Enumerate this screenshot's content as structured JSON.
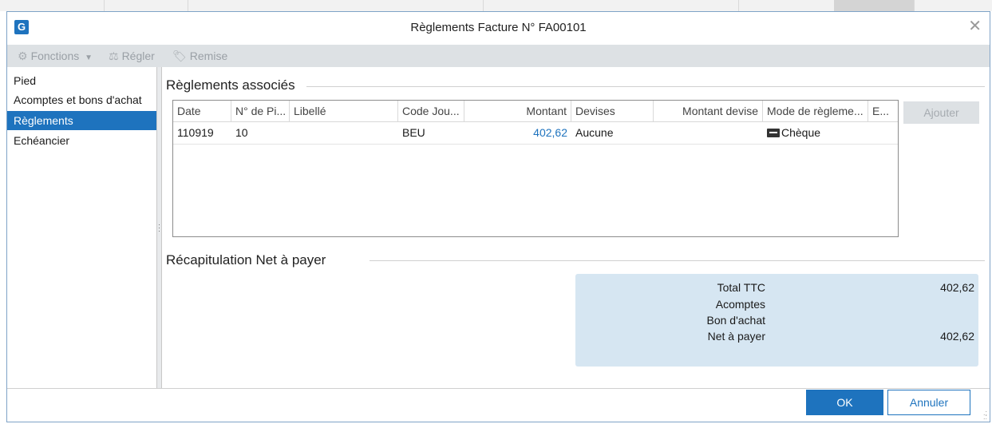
{
  "window": {
    "title": "Règlements Facture N° FA00101",
    "close_glyph": "✕",
    "app_icon_glyph": "G"
  },
  "toolbar": {
    "items": [
      {
        "label": "Fonctions",
        "icon": "gears-icon",
        "has_dropdown": true
      },
      {
        "label": "Régler",
        "icon": "scale-icon"
      },
      {
        "label": "Remise",
        "icon": "tag-icon"
      }
    ]
  },
  "nav": {
    "items": [
      {
        "label": "Pied",
        "selected": false
      },
      {
        "label": "Acomptes et bons d'achat",
        "selected": false
      },
      {
        "label": "Règlements",
        "selected": true
      },
      {
        "label": "Echéancier",
        "selected": false
      }
    ]
  },
  "payments": {
    "section_title": "Règlements associés",
    "add_button": "Ajouter",
    "columns": [
      "Date",
      "N° de Pi...",
      "Libellé",
      "Code Jou...",
      "Montant",
      "Devises",
      "Montant devise",
      "Mode de règleme...",
      "E..."
    ],
    "rows": [
      {
        "date": "110919",
        "piece": "10",
        "libelle": "",
        "code_journal": "BEU",
        "montant": "402,62",
        "devises": "Aucune",
        "montant_devise": "",
        "mode": "Chèque",
        "mode_icon": "payment-card-icon",
        "e": ""
      }
    ]
  },
  "summary": {
    "section_title": "Récapitulation Net à payer",
    "lines": [
      {
        "label": "Total TTC",
        "value": "402,62"
      },
      {
        "label": "Acomptes",
        "value": ""
      },
      {
        "label": "Bon d'achat",
        "value": ""
      },
      {
        "label": "Net à payer",
        "value": "402,62"
      }
    ]
  },
  "footer": {
    "ok": "OK",
    "cancel": "Annuler"
  },
  "colors": {
    "accent": "#1e73be",
    "summary_bg": "#d6e6f2",
    "toolbar_bg": "#dde1e4"
  }
}
